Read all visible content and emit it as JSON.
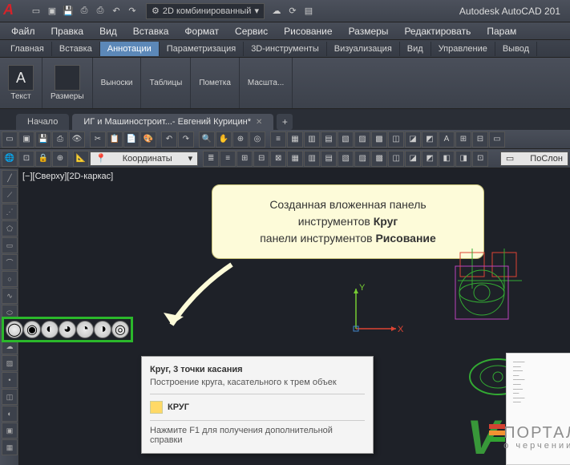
{
  "titlebar": {
    "app_name": "Autodesk AutoCAD 201",
    "workspace_combo": "2D комбинированный",
    "gear_icon": "⚙"
  },
  "menubar": [
    "Файл",
    "Правка",
    "Вид",
    "Вставка",
    "Формат",
    "Сервис",
    "Рисование",
    "Размеры",
    "Редактировать",
    "Парам"
  ],
  "ribbon_tabs": [
    "Главная",
    "Вставка",
    "Аннотации",
    "Параметризация",
    "3D-инструменты",
    "Визуализация",
    "Вид",
    "Управление",
    "Вывод"
  ],
  "ribbon_active": 2,
  "ribbon_groups": [
    "Текст",
    "Размеры",
    "Выноски",
    "Таблицы",
    "Пометка",
    "Масшта..."
  ],
  "doc_tabs": {
    "start": "Начало",
    "active": "ИГ и Машиностроит...- Евгений Курицин*"
  },
  "toolbar2": {
    "coord_label": "Координаты",
    "poslon": "ПоСлон"
  },
  "canvas": {
    "view_label": "[−][Сверху][2D-каркас]",
    "ucs_x": "X",
    "ucs_y": "Y"
  },
  "callout": {
    "line1": "Созданная вложенная панель",
    "line2_pre": "инструментов ",
    "line2_bold": "Круг",
    "line3_pre": "панели инструментов ",
    "line3_bold": "Рисование"
  },
  "tooltip": {
    "title": "Круг, 3 точки касания",
    "desc": "Построение круга, касательного к трем объек",
    "cmd": "КРУГ",
    "help": "Нажмите F1 для получения дополнительной справки"
  },
  "watermark": {
    "title": "ПОРТАЛ",
    "sub": "о черчении"
  }
}
